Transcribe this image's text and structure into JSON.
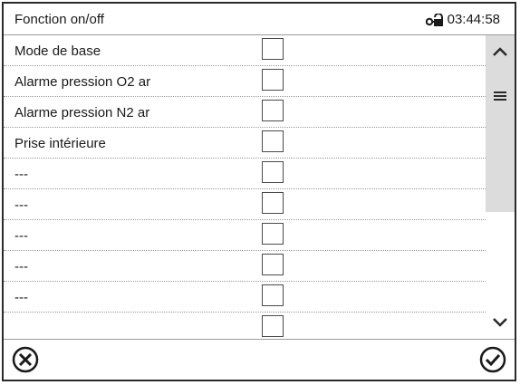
{
  "header": {
    "title": "Fonction on/off",
    "time": "03:44:58",
    "lock_icon": "lock-key-icon"
  },
  "rows": [
    {
      "label": "Mode de base",
      "checked": false
    },
    {
      "label": "Alarme pression O2 ar",
      "checked": false
    },
    {
      "label": "Alarme pression N2 ar",
      "checked": false
    },
    {
      "label": "Prise intérieure",
      "checked": false
    },
    {
      "label": "---",
      "checked": false
    },
    {
      "label": "---",
      "checked": false
    },
    {
      "label": "---",
      "checked": false
    },
    {
      "label": "---",
      "checked": false
    },
    {
      "label": "---",
      "checked": false
    },
    {
      "label": "",
      "checked": false
    }
  ],
  "scrollbar": {
    "up_icon": "chevron-up-icon",
    "down_icon": "chevron-down-icon",
    "grip_icon": "menu-grip-icon"
  },
  "footer": {
    "cancel_icon": "cancel-circle-icon",
    "confirm_icon": "check-circle-icon"
  }
}
